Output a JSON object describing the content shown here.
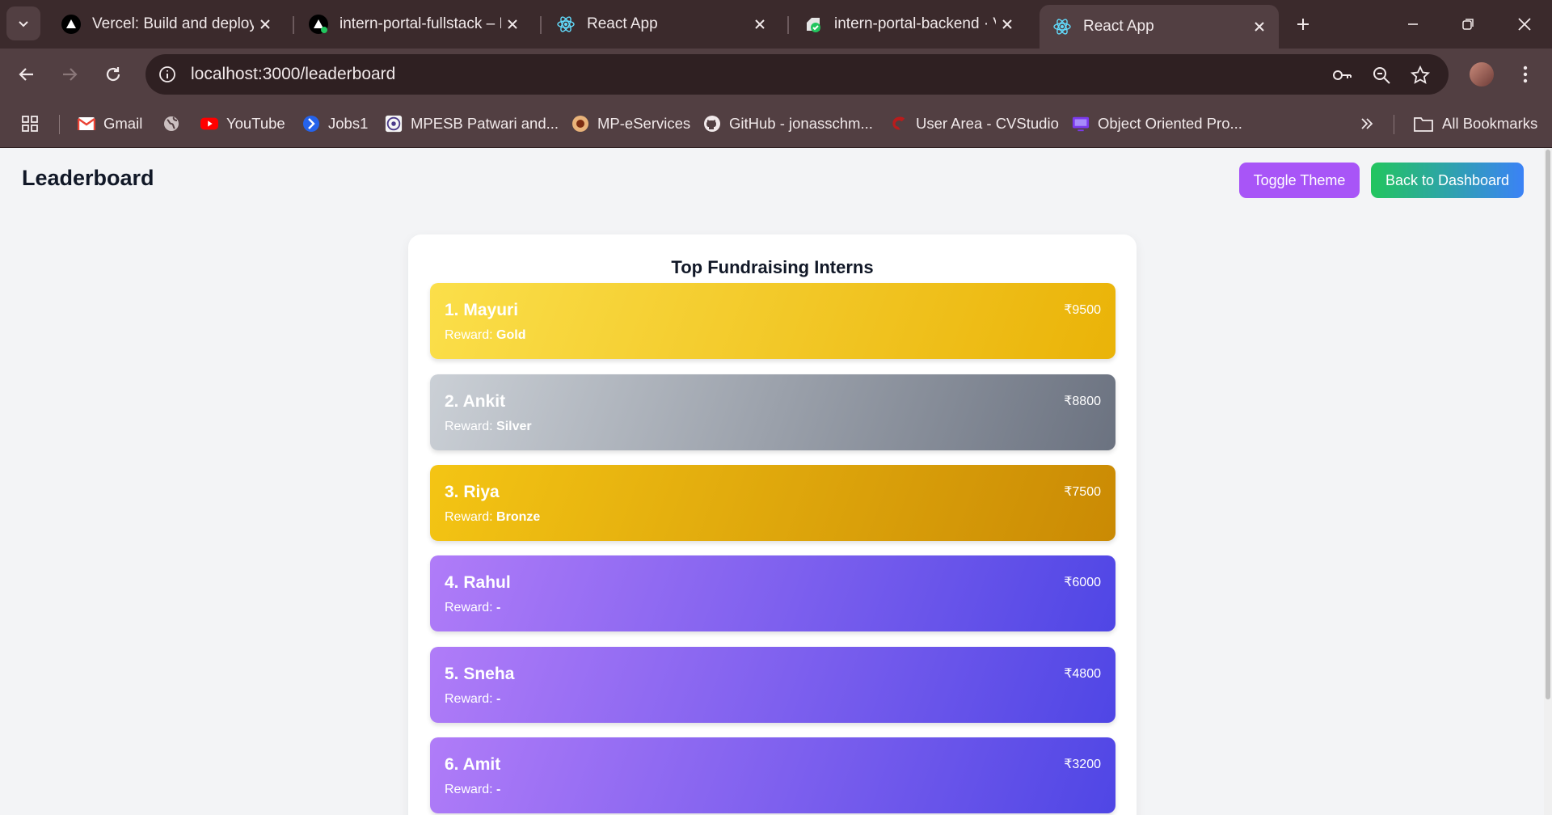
{
  "browser": {
    "tabs": [
      {
        "title": "Vercel: Build and deploy the",
        "icon": "vercel-icon",
        "active": false
      },
      {
        "title": "intern-portal-fullstack – Depl",
        "icon": "vercel-icon",
        "active": false
      },
      {
        "title": "React App",
        "icon": "react-icon",
        "active": false
      },
      {
        "title": "intern-portal-backend · Verc",
        "icon": "deploy-check-icon",
        "active": false
      },
      {
        "title": "React App",
        "icon": "react-icon",
        "active": true
      }
    ],
    "url": "localhost:3000/leaderboard",
    "bookmarks": [
      {
        "label": "Gmail",
        "icon": "gmail-icon"
      },
      {
        "label": "",
        "icon": "globe-icon"
      },
      {
        "label": "YouTube",
        "icon": "youtube-icon"
      },
      {
        "label": "Jobs1",
        "icon": "jobs-icon"
      },
      {
        "label": "MPESB Patwari and...",
        "icon": "mpesb-icon"
      },
      {
        "label": "MP-eServices",
        "icon": "eservices-icon"
      },
      {
        "label": "GitHub - jonasschm...",
        "icon": "github-icon"
      },
      {
        "label": "User Area - CVStudio",
        "icon": "cvstudio-icon"
      },
      {
        "label": "Object Oriented Pro...",
        "icon": "oop-icon"
      }
    ],
    "all_bookmarks_label": "All Bookmarks"
  },
  "page": {
    "title": "Leaderboard",
    "toggle_theme_label": "Toggle Theme",
    "back_label": "Back to Dashboard",
    "card_title": "Top Fundraising Interns",
    "reward_prefix": "Reward:",
    "colors": {
      "gold": [
        "#fbdf4a",
        "#eab308"
      ],
      "silver": [
        "#cbd0d6",
        "#6b7280"
      ],
      "bronze": [
        "#f4c514",
        "#ca8a04"
      ],
      "default": [
        "#b07cf8",
        "#4f46e5"
      ],
      "toggle_theme": "#a855f7",
      "dashboard_from": "#22c55e",
      "dashboard_to": "#3b82f6"
    },
    "entries": [
      {
        "name": "1. Mayuri",
        "amount": "₹9500",
        "reward": "Gold"
      },
      {
        "name": "2. Ankit",
        "amount": "₹8800",
        "reward": "Silver"
      },
      {
        "name": "3. Riya",
        "amount": "₹7500",
        "reward": "Bronze"
      },
      {
        "name": "4. Rahul",
        "amount": "₹6000",
        "reward": "-"
      },
      {
        "name": "5. Sneha",
        "amount": "₹4800",
        "reward": "-"
      },
      {
        "name": "6. Amit",
        "amount": "₹3200",
        "reward": "-"
      }
    ]
  }
}
